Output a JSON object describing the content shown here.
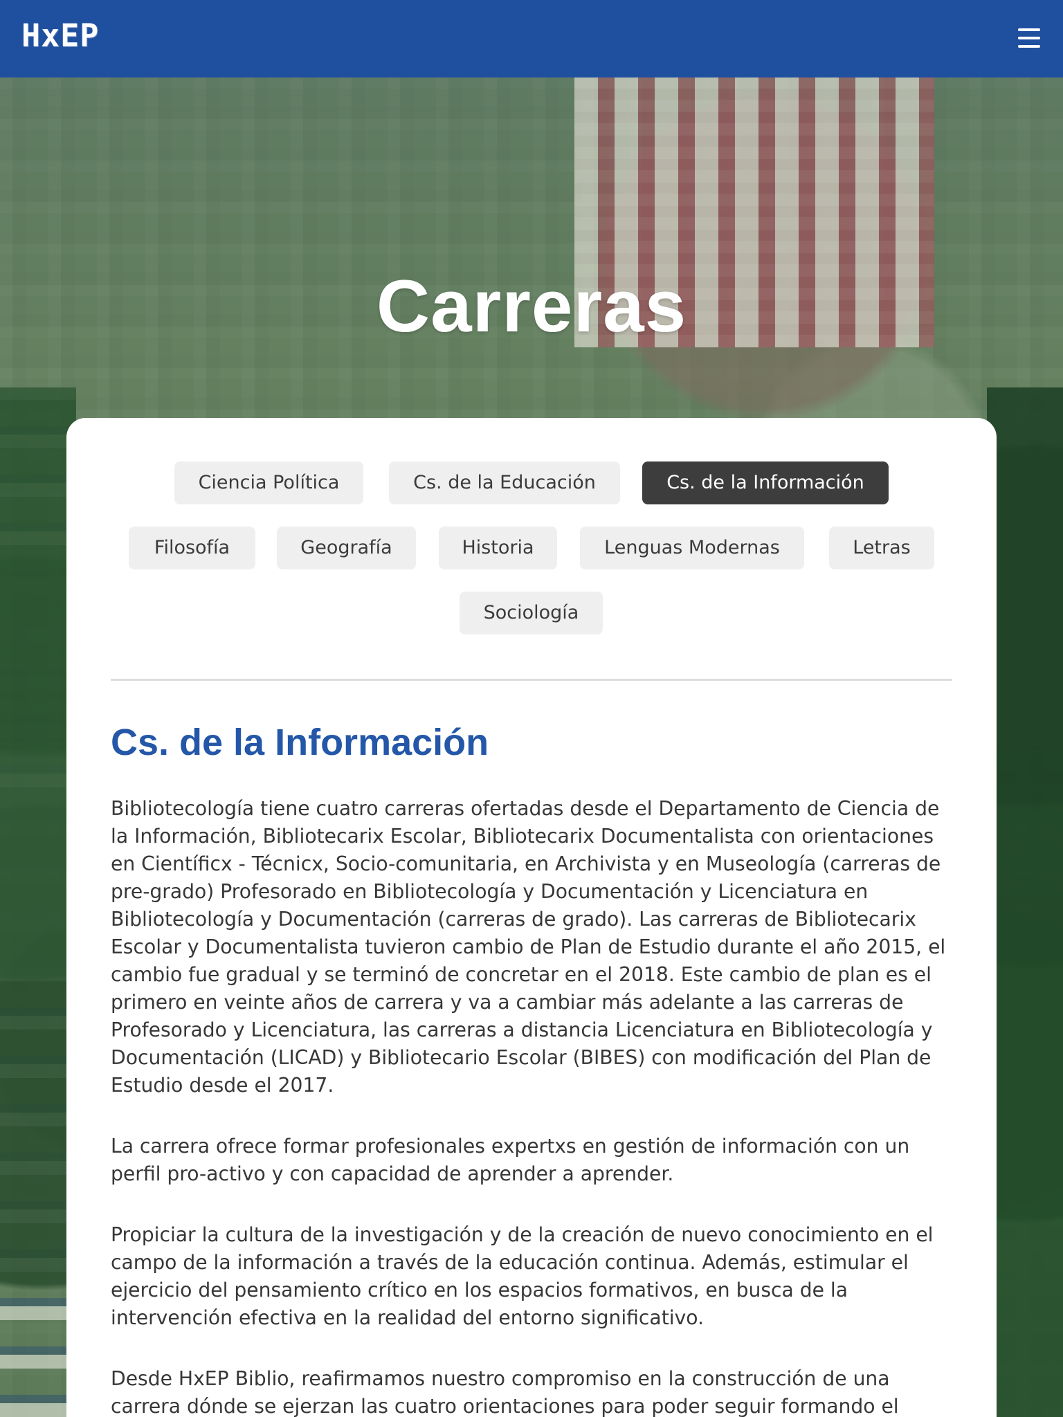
{
  "header": {
    "logo": "HxEP",
    "menu_icon": "hamburger-menu-icon"
  },
  "hero": {
    "title": "Carreras"
  },
  "tabs": [
    {
      "label": "Ciencia Política",
      "active": false
    },
    {
      "label": "Cs. de la Educación",
      "active": false
    },
    {
      "label": "Cs. de la Información",
      "active": true
    },
    {
      "label": "Filosofía",
      "active": false
    },
    {
      "label": "Geografía",
      "active": false
    },
    {
      "label": "Historia",
      "active": false
    },
    {
      "label": "Lenguas Modernas",
      "active": false
    },
    {
      "label": "Letras",
      "active": false
    },
    {
      "label": "Sociología",
      "active": false
    }
  ],
  "content": {
    "title": "Cs. de la Información",
    "paragraphs": [
      "Bibliotecología tiene cuatro carreras ofertadas desde el Departamento de Ciencia de la Información, Bibliotecarix Escolar, Bibliotecarix Documentalista con orientaciones en Científicx - Técnicx, Socio-comunitaria, en Archivista y en Museología (carreras de pre-grado) Profesorado en Bibliotecología y Documentación y Licenciatura en Bibliotecología y Documentación (carreras de grado). Las carreras de Bibliotecarix Escolar y Documentalista tuvieron cambio de Plan de Estudio durante el año 2015, el cambio fue gradual y se terminó de concretar en el 2018. Este cambio de plan es el primero en veinte años de carrera y va a cambiar más adelante a las carreras de Profesorado y Licenciatura, las carreras a distancia Licenciatura en Bibliotecología y Documentación (LICAD) y Bibliotecario Escolar (BIBES) con modificación del Plan de Estudio desde el 2017.",
      "La carrera ofrece formar profesionales expertxs en gestión de información con un perfil pro-activo y con capacidad de aprender a aprender.",
      "Propiciar la cultura de la investigación y de la creación de nuevo conocimiento en el campo de la información a través de la educación continua. Además, estimular el ejercicio del pensamiento crítico en los espacios formativos, en busca de la intervención efectiva en la realidad del entorno significativo.",
      "Desde HxEP Biblio, reafirmamos nuestro compromiso en la construcción de una carrera dónde se ejerzan las cuatro orientaciones para poder seguir formando el"
    ]
  },
  "colors": {
    "header": "#1f4f9f",
    "active_tab": "#3d3d3d",
    "tab": "#efefef",
    "title_blue": "#2457a8",
    "text": "#373737"
  }
}
